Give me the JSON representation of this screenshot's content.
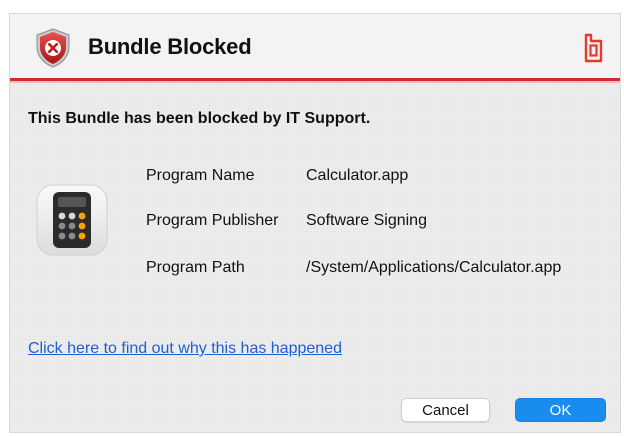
{
  "dialog": {
    "title": "Bundle Blocked",
    "headline": "This Bundle has been blocked by IT Support.",
    "info": [
      {
        "label": "Program Name",
        "value": "Calculator.app"
      },
      {
        "label": "Program Publisher",
        "value": "Software Signing"
      },
      {
        "label": "Program Path",
        "value": "/System/Applications/Calculator.app"
      }
    ],
    "help_link": "Click here to find out why this has happened",
    "buttons": {
      "cancel": "Cancel",
      "ok": "OK"
    }
  },
  "icons": {
    "title_icon": "shield-x-icon",
    "brand_icon": "brand-logo-icon",
    "app_icon": "calculator-app-icon"
  },
  "colors": {
    "accent_red": "#d12b2b",
    "link_blue": "#1a5fd6",
    "ok_blue": "#1a8cf0"
  }
}
